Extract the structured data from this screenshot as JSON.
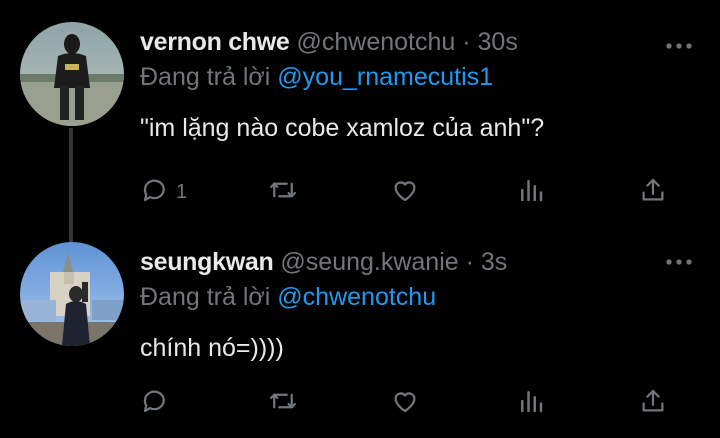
{
  "tweets": [
    {
      "name": "vernon chwe",
      "handle": "@chwenotchu",
      "time": "30s",
      "reply_prefix": "Đang trả lời",
      "reply_to": "@you_rnamecutis1",
      "text": "\"im lặng nào cobe xamloz của anh\"?",
      "reply_count": "1"
    },
    {
      "name": "seungkwan",
      "handle": "@seung.kwanie",
      "time": "3s",
      "reply_prefix": "Đang trả lời",
      "reply_to": "@chwenotchu",
      "text": "chính nó=))))",
      "reply_count": ""
    }
  ],
  "separator": " · ",
  "icons": [
    "reply-icon",
    "retweet-icon",
    "like-icon",
    "views-icon",
    "share-icon",
    "more-icon"
  ],
  "colors": {
    "background": "#000000",
    "text": "#e7e9ea",
    "muted": "#71767b",
    "link": "#1d9bf0"
  }
}
